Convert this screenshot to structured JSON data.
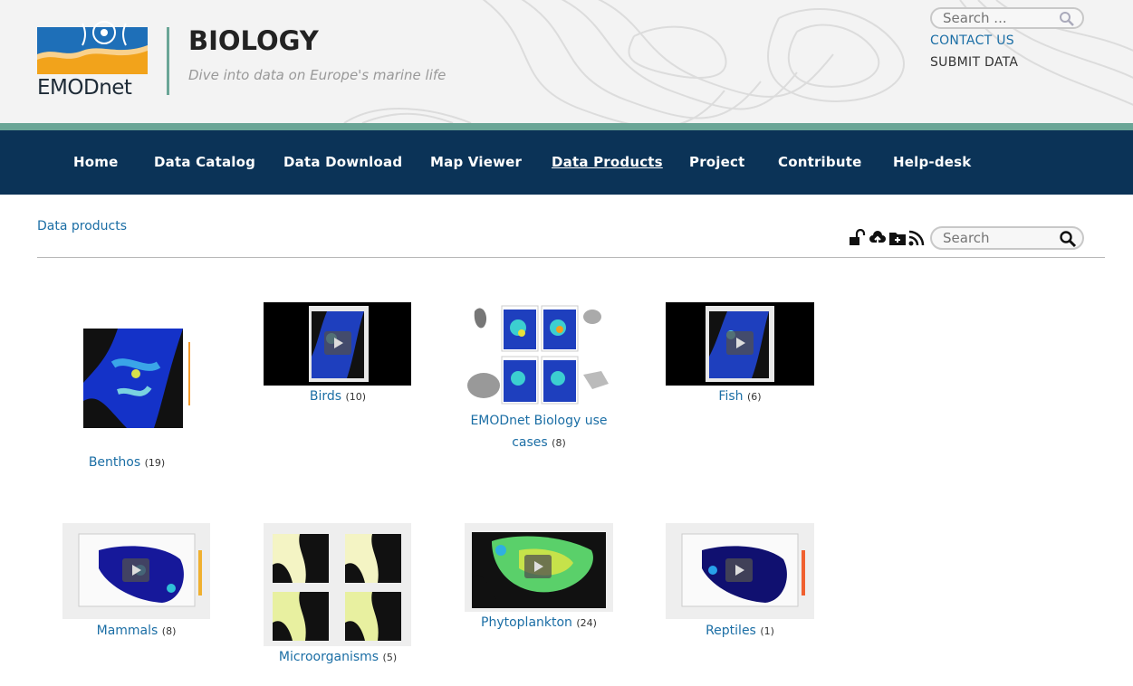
{
  "header": {
    "logo_text": "EMODnet",
    "site_title": "BIOLOGY",
    "tagline": "Dive into data on Europe's marine life",
    "search_placeholder": "Search ...",
    "contact_label": "CONTACT US",
    "submit_label": "SUBMIT DATA"
  },
  "nav": {
    "items": [
      {
        "label": "Home"
      },
      {
        "label": "Data Catalog"
      },
      {
        "label": "Data Download"
      },
      {
        "label": "Map Viewer"
      },
      {
        "label": "Data Products",
        "active": true
      },
      {
        "label": "Project"
      },
      {
        "label": "Contribute"
      },
      {
        "label": "Help-desk"
      }
    ]
  },
  "content": {
    "breadcrumb": "Data products",
    "search_placeholder": "Search",
    "toolbar_icons": [
      "unlock-icon",
      "cloud-upload-icon",
      "add-folder-icon",
      "rss-icon"
    ],
    "categories": [
      {
        "name": "Benthos",
        "count": "(19)",
        "video": false
      },
      {
        "name": "Birds",
        "count": "(10)",
        "video": true
      },
      {
        "name": "EMODnet Biology use",
        "name2": "cases",
        "count": "(8)",
        "video": false
      },
      {
        "name": "Fish",
        "count": "(6)",
        "video": true
      },
      {
        "name": "Mammals",
        "count": "(8)",
        "video": true
      },
      {
        "name": "Microorganisms",
        "count": "(5)",
        "video": false
      },
      {
        "name": "Phytoplankton",
        "count": "(24)",
        "video": true
      },
      {
        "name": "Reptiles",
        "count": "(1)",
        "video": true
      }
    ]
  },
  "colors": {
    "nav_bg": "#0b3357",
    "link": "#1b6ea5",
    "accent_teal": "#6aa596"
  }
}
